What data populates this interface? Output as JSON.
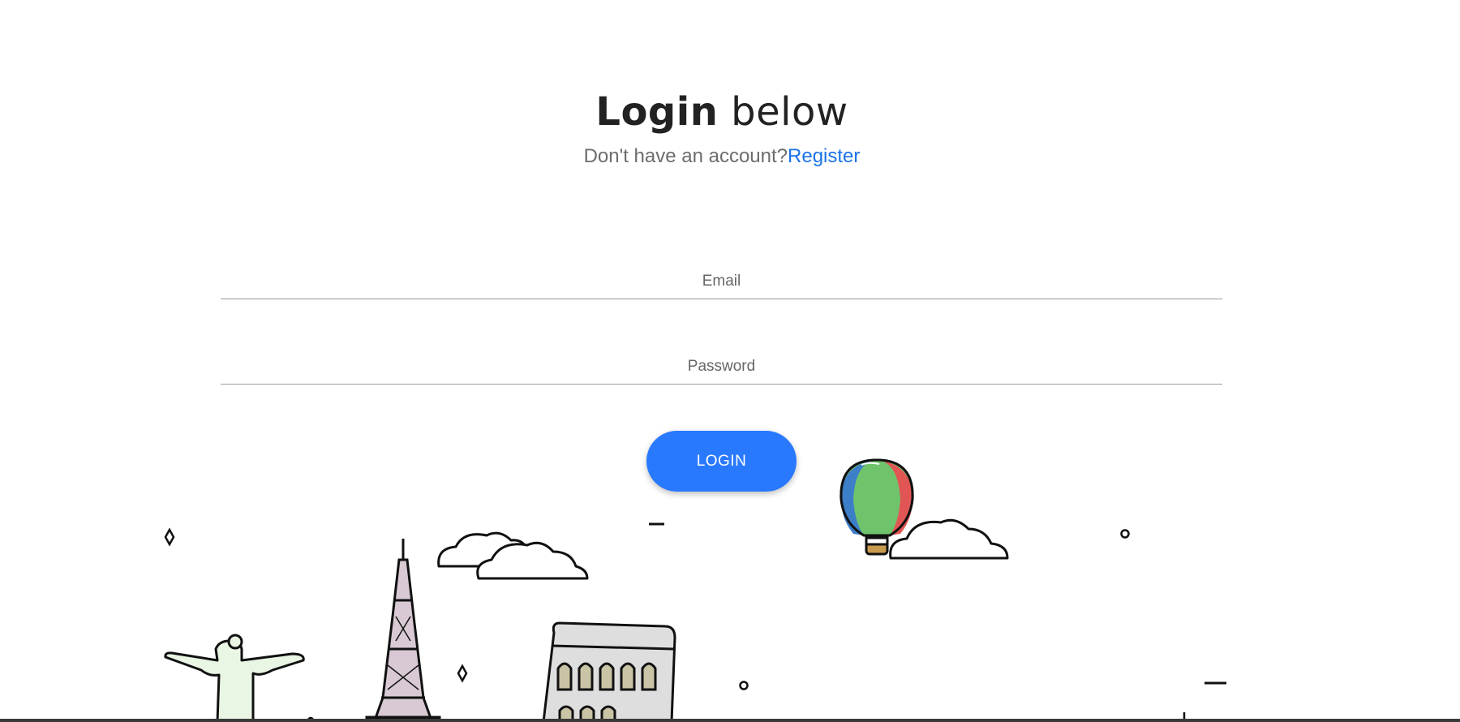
{
  "header": {
    "title_bold": "Login",
    "title_rest": "below",
    "prompt": "Don't have an account?",
    "register_link": "Register"
  },
  "form": {
    "email_placeholder": "Email",
    "password_placeholder": "Password",
    "submit_label": "LOGIN"
  },
  "colors": {
    "accent": "#2979ff",
    "link": "#1a73e8"
  },
  "illustration": {
    "icons": [
      "christ-redeemer-icon",
      "eiffel-tower-icon",
      "colosseum-icon",
      "hot-air-balloon-icon",
      "cloud-icon"
    ]
  }
}
